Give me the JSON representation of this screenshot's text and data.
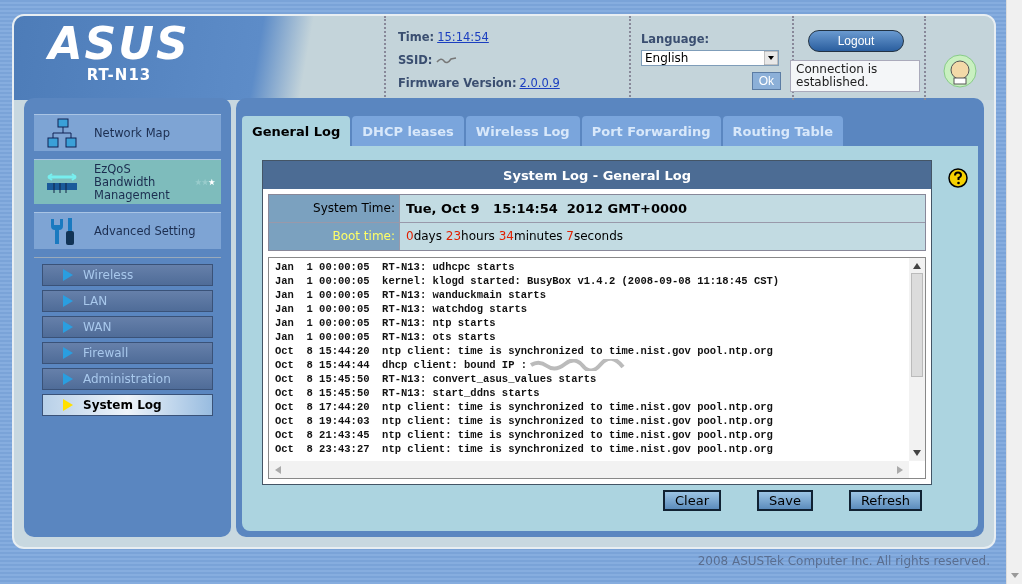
{
  "header": {
    "logo": "ASUS",
    "model": "RT-N13",
    "time_label": "Time:",
    "time": "15:14:54",
    "ssid_label": "SSID:",
    "firmware_label": "Firmware Version:",
    "firmware": "2.0.0.9",
    "language_label": "Language:",
    "language": "English",
    "ok_button": "Ok",
    "logout_button": "Logout",
    "tooltip": "Connection is established."
  },
  "sidebar": {
    "items": [
      {
        "label": "Network Map",
        "kind": "network",
        "selected": false
      },
      {
        "label": "EzQoS Bandwidth Management",
        "kind": "qos",
        "selected": true
      },
      {
        "label": "Advanced Setting",
        "kind": "tools",
        "selected": false
      }
    ],
    "submenu": [
      {
        "label": "Wireless",
        "selected": false
      },
      {
        "label": "LAN",
        "selected": false
      },
      {
        "label": "WAN",
        "selected": false
      },
      {
        "label": "Firewall",
        "selected": false
      },
      {
        "label": "Administration",
        "selected": false
      },
      {
        "label": "System Log",
        "selected": true
      }
    ]
  },
  "tabs": [
    {
      "label": "General Log",
      "selected": true
    },
    {
      "label": "DHCP leases",
      "selected": false
    },
    {
      "label": "Wireless Log",
      "selected": false
    },
    {
      "label": "Port Forwarding",
      "selected": false
    },
    {
      "label": "Routing Table",
      "selected": false
    }
  ],
  "panel": {
    "title": "System Log - General Log",
    "system_time_label": "System Time:",
    "system_time": "Tue, Oct 9   15:14:54  2012 GMT+0000",
    "boot_time_label": "Boot time:",
    "boot_time": [
      {
        "value": "0",
        "unit": "days"
      },
      {
        "value": "23",
        "unit": "hours"
      },
      {
        "value": "34",
        "unit": "minutes"
      },
      {
        "value": "7",
        "unit": "seconds"
      }
    ],
    "log": [
      {
        "text": "Jan  1 00:00:05  RT-N13: udhcpc starts",
        "redacted": false
      },
      {
        "text": "Jan  1 00:00:05  kernel: klogd started: BusyBox v1.4.2 (2008-09-08 11:18:45 CST)",
        "redacted": false
      },
      {
        "text": "Jan  1 00:00:05  RT-N13: wanduckmain starts",
        "redacted": false
      },
      {
        "text": "Jan  1 00:00:05  RT-N13: watchdog starts",
        "redacted": false
      },
      {
        "text": "Jan  1 00:00:05  RT-N13: ntp starts",
        "redacted": false
      },
      {
        "text": "Jan  1 00:00:05  RT-N13: ots starts",
        "redacted": false
      },
      {
        "text": "Oct  8 15:44:20  ntp client: time is synchronized to time.nist.gov pool.ntp.org",
        "redacted": false
      },
      {
        "text": "Oct  8 15:44:44  dhcp client: bound IP :",
        "redacted": true
      },
      {
        "text": "Oct  8 15:45:50  RT-N13: convert_asus_values starts",
        "redacted": false
      },
      {
        "text": "Oct  8 15:45:50  RT-N13: start_ddns starts",
        "redacted": false
      },
      {
        "text": "Oct  8 17:44:20  ntp client: time is synchronized to time.nist.gov pool.ntp.org",
        "redacted": false
      },
      {
        "text": "Oct  8 19:44:03  ntp client: time is synchronized to time.nist.gov pool.ntp.org",
        "redacted": false
      },
      {
        "text": "Oct  8 21:43:45  ntp client: time is synchronized to time.nist.gov pool.ntp.org",
        "redacted": false
      },
      {
        "text": "Oct  8 23:43:27  ntp client: time is synchronized to time.nist.gov pool.ntp.org",
        "redacted": false
      }
    ],
    "buttons": [
      "Clear",
      "Save",
      "Refresh"
    ]
  },
  "footer": "2008 ASUSTek Computer Inc. All rights reserved."
}
